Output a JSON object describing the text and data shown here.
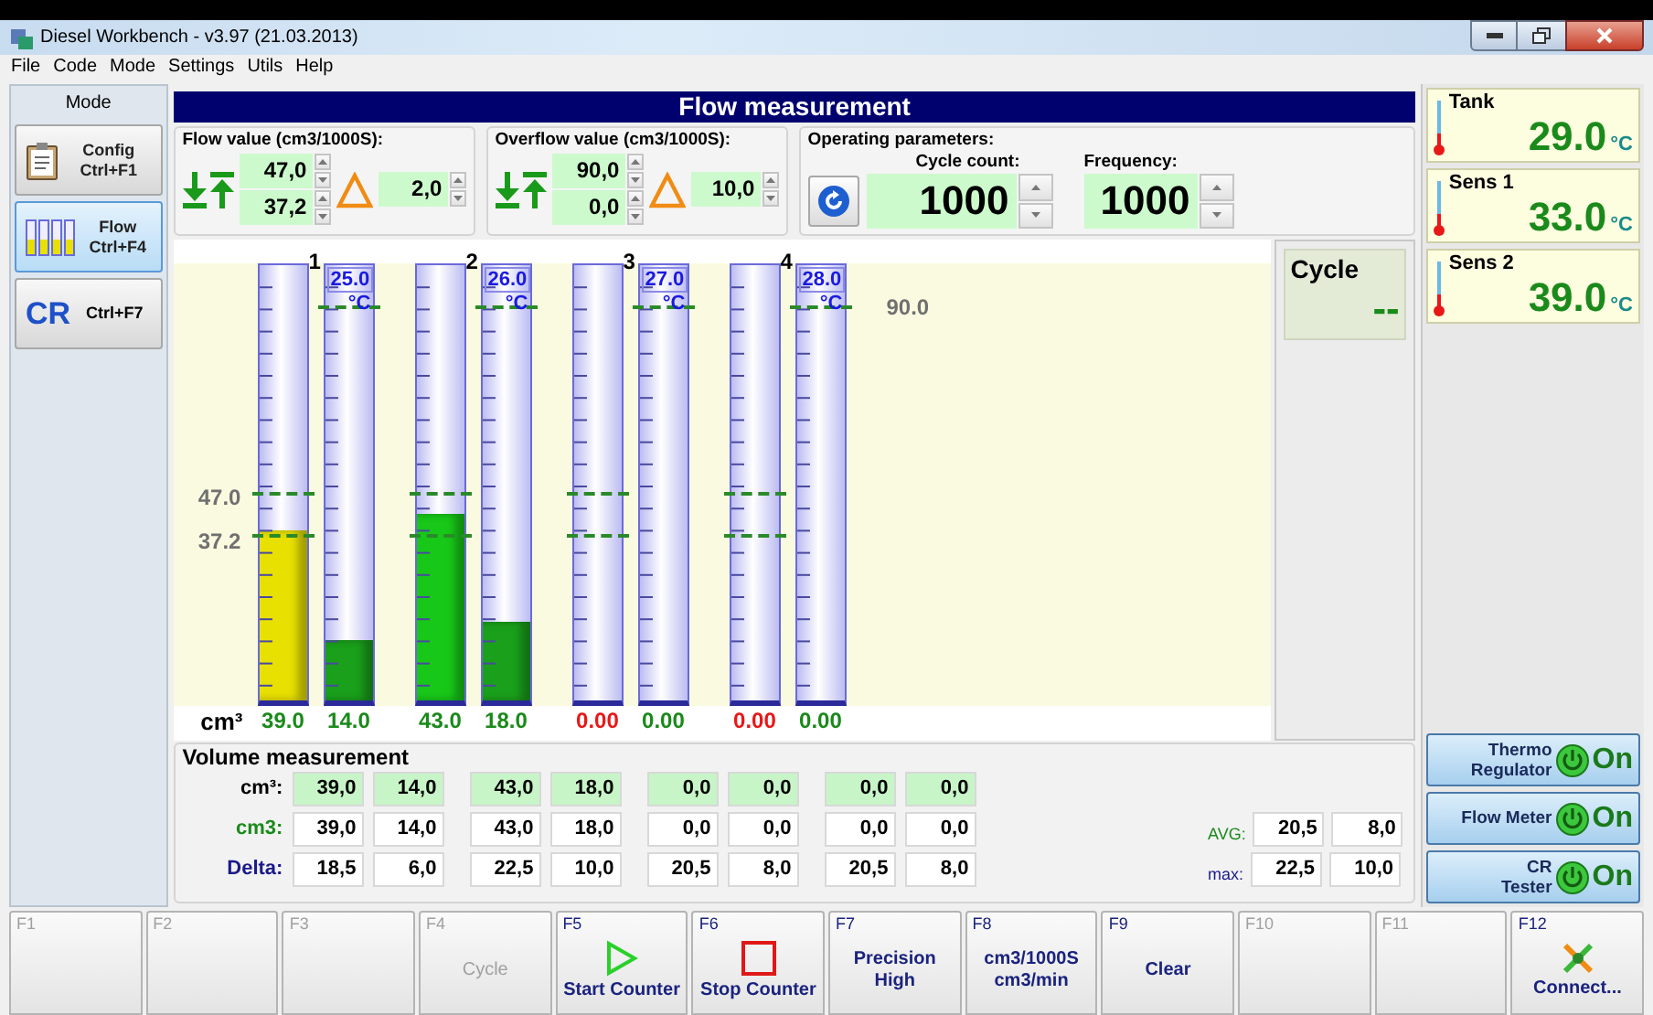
{
  "window": {
    "title": "Diesel Workbench - v3.97 (21.03.2013)"
  },
  "menu": [
    "File",
    "Code",
    "Mode",
    "Settings",
    "Utils",
    "Help"
  ],
  "mode_panel": {
    "title": "Mode",
    "items": [
      {
        "label": "Config",
        "shortcut": "Ctrl+F1",
        "kind": "config",
        "selected": false
      },
      {
        "label": "Flow",
        "shortcut": "Ctrl+F4",
        "kind": "flow",
        "selected": true
      },
      {
        "label": "CR",
        "shortcut": "Ctrl+F7",
        "kind": "cr",
        "selected": false
      }
    ]
  },
  "header": "Flow measurement",
  "flow_value": {
    "title": "Flow value (cm3/1000S):",
    "upper": "47,0",
    "lower": "37,2",
    "delta": "2,0"
  },
  "overflow_value": {
    "title": "Overflow value (cm3/1000S):",
    "upper": "90,0",
    "lower": "0,0",
    "delta": "10,0"
  },
  "operating_parameters": {
    "title": "Operating parameters:",
    "cycle_count_label": "Cycle count:",
    "cycle_count": "1000",
    "frequency_label": "Frequency:",
    "frequency": "1000"
  },
  "chart": {
    "unit": "cm³",
    "limits": [
      {
        "label": "47.0",
        "level": 0.47
      },
      {
        "label": "37.2",
        "level": 0.372
      }
    ],
    "temp_limit": {
      "label": "90.0",
      "level": 0.9
    },
    "pairs": [
      {
        "number": "1",
        "flow": {
          "level": 0.39,
          "color": "#e8e000",
          "reading": "39.0",
          "alert": false
        },
        "overflow": {
          "level": 0.14,
          "color": "#1aa01a",
          "reading": "14.0",
          "temperature": "25.0",
          "temperature_unit": "°C",
          "alert": false
        }
      },
      {
        "number": "2",
        "flow": {
          "level": 0.43,
          "color": "#18c818",
          "reading": "43.0",
          "alert": false
        },
        "overflow": {
          "level": 0.18,
          "color": "#1aa01a",
          "reading": "18.0",
          "temperature": "26.0",
          "temperature_unit": "°C",
          "alert": false
        }
      },
      {
        "number": "3",
        "flow": {
          "reading": "0.00",
          "alert": true
        },
        "overflow": {
          "reading": "0.00",
          "temperature": "27.0",
          "temperature_unit": "°C",
          "alert": false
        }
      },
      {
        "number": "4",
        "flow": {
          "reading": "0.00",
          "alert": true
        },
        "overflow": {
          "reading": "0.00",
          "temperature": "28.0",
          "temperature_unit": "°C",
          "alert": false
        }
      }
    ]
  },
  "cycle": {
    "label": "Cycle",
    "value": "--"
  },
  "volume": {
    "title": "Volume measurement",
    "rows": [
      {
        "label": "cm³:",
        "kind": "measured",
        "values": [
          "39,0",
          "14,0",
          "43,0",
          "18,0",
          "0,0",
          "0,0",
          "0,0",
          "0,0"
        ]
      },
      {
        "label": "cm3:",
        "kind": "rate",
        "values": [
          "39,0",
          "14,0",
          "43,0",
          "18,0",
          "0,0",
          "0,0",
          "0,0",
          "0,0"
        ]
      },
      {
        "label": "Delta:",
        "kind": "delta",
        "values": [
          "18,5",
          "6,0",
          "22,5",
          "10,0",
          "20,5",
          "8,0",
          "20,5",
          "8,0"
        ]
      }
    ],
    "stats": [
      {
        "label": "AVG:",
        "kind": "average",
        "values": [
          "20,5",
          "8,0"
        ]
      },
      {
        "label": "max:",
        "kind": "maximum",
        "values": [
          "22,5",
          "10,0"
        ]
      }
    ]
  },
  "sensors": [
    {
      "name": "Tank",
      "value": "29.0",
      "unit": "°C"
    },
    {
      "name": "Sens 1",
      "value": "33.0",
      "unit": "°C"
    },
    {
      "name": "Sens 2",
      "value": "39.0",
      "unit": "°C"
    }
  ],
  "toggles": [
    {
      "lines": [
        "Thermo",
        "Regulator"
      ],
      "on": true,
      "state": "On"
    },
    {
      "lines": [
        "Flow Meter"
      ],
      "on": true,
      "state": "On"
    },
    {
      "lines": [
        "CR",
        "Tester"
      ],
      "on": true,
      "state": "On"
    }
  ],
  "function_keys": [
    {
      "key": "F1",
      "kind": "blank",
      "disabled": true
    },
    {
      "key": "F2",
      "kind": "blank",
      "disabled": true
    },
    {
      "key": "F3",
      "kind": "blank",
      "disabled": true
    },
    {
      "key": "F4",
      "kind": "text",
      "lines": [
        "Cycle"
      ],
      "disabled": true
    },
    {
      "key": "F5",
      "kind": "play",
      "lines": [
        "Start Counter"
      ],
      "disabled": false
    },
    {
      "key": "F6",
      "kind": "stop",
      "lines": [
        "Stop Counter"
      ],
      "disabled": false
    },
    {
      "key": "F7",
      "kind": "text",
      "lines": [
        "Precision",
        "High"
      ],
      "disabled": false
    },
    {
      "key": "F8",
      "kind": "text",
      "lines": [
        "cm3/1000S",
        "cm3/min"
      ],
      "disabled": false
    },
    {
      "key": "F9",
      "kind": "text",
      "lines": [
        "Clear"
      ],
      "disabled": false
    },
    {
      "key": "F10",
      "kind": "blank",
      "disabled": true
    },
    {
      "key": "F11",
      "kind": "blank",
      "disabled": true
    },
    {
      "key": "F12",
      "kind": "connect",
      "lines": [
        "Connect..."
      ],
      "disabled": false
    }
  ]
}
